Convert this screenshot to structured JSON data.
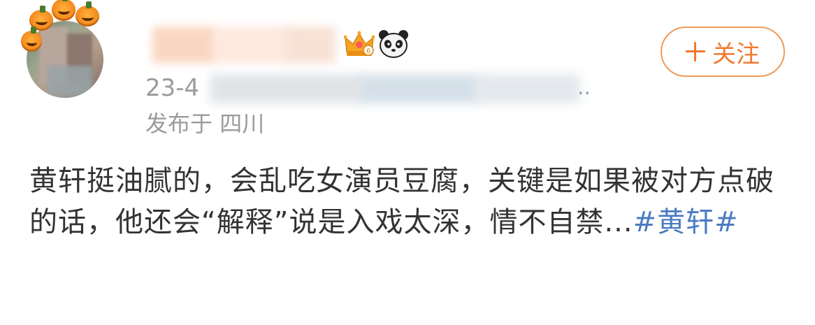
{
  "user": {
    "avatar_icon": "avatar-with-pumpkin-decoration",
    "name": "",
    "badges": [
      "crown-vip-icon",
      "panda-icon"
    ]
  },
  "follow_button": {
    "label": "关注",
    "icon": "plus-icon",
    "color": "#f07a2f"
  },
  "meta": {
    "time_prefix": "23-4",
    "time_suffix": "..",
    "location_prefix": "发布于",
    "location": "四川"
  },
  "post": {
    "text": "黄轩挺油腻的，会乱吃女演员豆腐，关键是如果被对方点破的话，他还会“解释”说是入戏太深，情不自禁...",
    "topic": "#黄轩#",
    "link_color": "#4b7bc2"
  }
}
